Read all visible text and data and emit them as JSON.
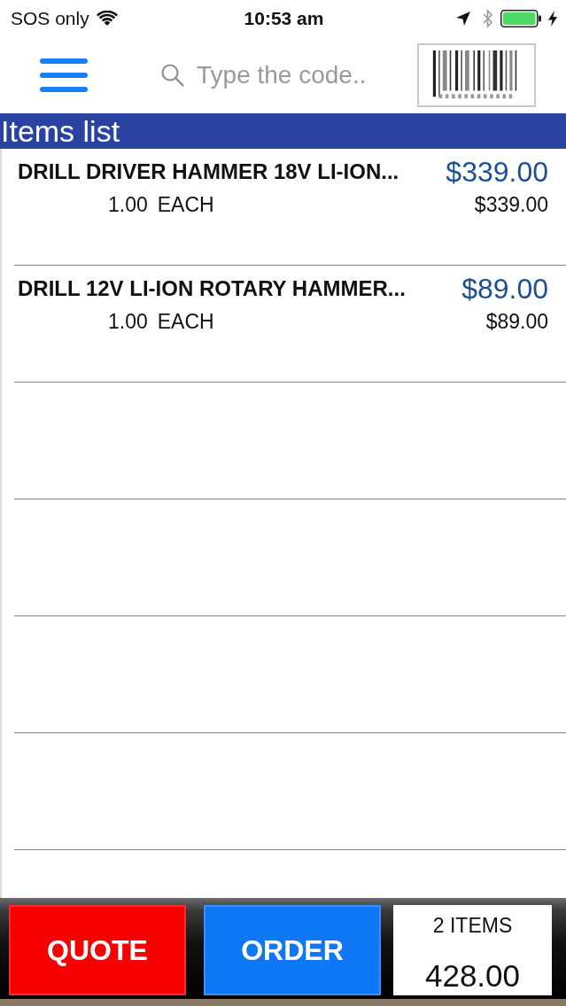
{
  "status_bar": {
    "carrier": "SOS only",
    "time": "10:53 am"
  },
  "nav_bar": {
    "search": {
      "placeholder": "Type the code.."
    }
  },
  "list_header": {
    "title": "Items list"
  },
  "items": [
    {
      "name": "DRILL DRIVER HAMMER 18V LI-ION...",
      "price": "$339.00",
      "quantity": "1.00",
      "unit": "EACH",
      "subtotal": "$339.00"
    },
    {
      "name": "DRILL 12V LI-ION ROTARY HAMMER...",
      "price": "$89.00",
      "quantity": "1.00",
      "unit": "EACH",
      "subtotal": "$89.00"
    }
  ],
  "footer": {
    "buttons": [
      {
        "label": "QUOTE",
        "kind": "quote"
      },
      {
        "label": "ORDER",
        "kind": "order"
      }
    ],
    "summary": {
      "count": "2 ITEMS",
      "total": "428.00"
    }
  }
}
